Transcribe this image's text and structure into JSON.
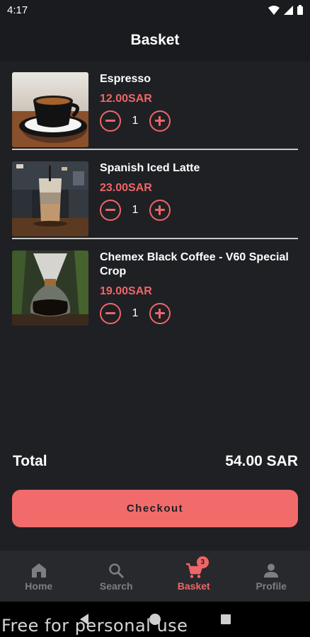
{
  "status_bar": {
    "time": "4:17"
  },
  "header": {
    "title": "Basket"
  },
  "items": [
    {
      "name": "Espresso",
      "price": "12.00SAR",
      "quantity": "1",
      "image": "espresso-cup"
    },
    {
      "name": "Spanish Iced Latte",
      "price": "23.00SAR",
      "quantity": "1",
      "image": "iced-latte-glass"
    },
    {
      "name": "Chemex Black Coffee - V60 Special Crop",
      "price": "19.00SAR",
      "quantity": "1",
      "image": "chemex-coffee"
    }
  ],
  "summary": {
    "total_label": "Total",
    "total_value": "54.00 SAR"
  },
  "checkout": {
    "label": "Checkout"
  },
  "nav": {
    "items": [
      {
        "label": "Home",
        "icon": "home-icon"
      },
      {
        "label": "Search",
        "icon": "search-icon"
      },
      {
        "label": "Basket",
        "icon": "cart-icon",
        "badge": "3",
        "active": true
      },
      {
        "label": "Profile",
        "icon": "person-icon"
      }
    ]
  },
  "watermark": "Free for personal use",
  "colors": {
    "background": "#1f2024",
    "accent": "#ee6667",
    "checkout_button": "#f26b6b",
    "nav_bar": "#28292d",
    "nav_inactive": "#7d7e82"
  }
}
